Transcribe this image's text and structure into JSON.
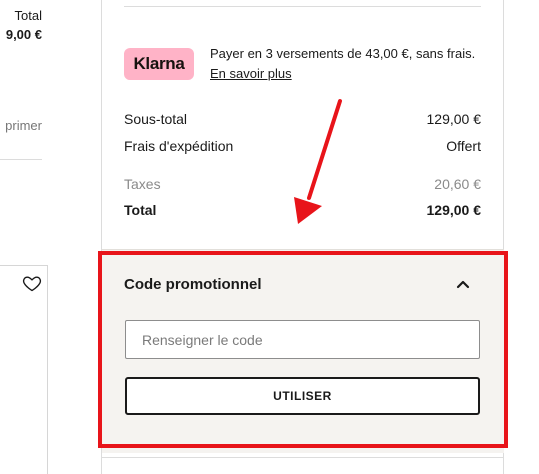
{
  "left_panel": {
    "total_label": "Total",
    "total_value": "9,00 €",
    "remove_label": "primer",
    "heart_icon": "heart-outline-icon"
  },
  "klarna": {
    "badge_label": "Klarna",
    "badge_color": "#ffb3c7",
    "text": "Payer en 3 versements de 43,00 €, sans frais.",
    "link_label": "En savoir plus"
  },
  "summary": {
    "subtotal_label": "Sous-total",
    "subtotal_value": "129,00 €",
    "shipping_label": "Frais d'expédition",
    "shipping_value": "Offert",
    "taxes_label": "Taxes",
    "taxes_value": "20,60 €",
    "total_label": "Total",
    "total_value": "129,00 €"
  },
  "promo": {
    "title": "Code promotionnel",
    "toggle_icon": "chevron-up-icon",
    "input_placeholder": "Renseigner le code",
    "input_value": "",
    "button_label": "UTILISER",
    "panel_color": "#f5f3f0"
  },
  "annotation": {
    "highlight_color": "#e8141a",
    "arrow_icon": "arrow-down-icon"
  }
}
